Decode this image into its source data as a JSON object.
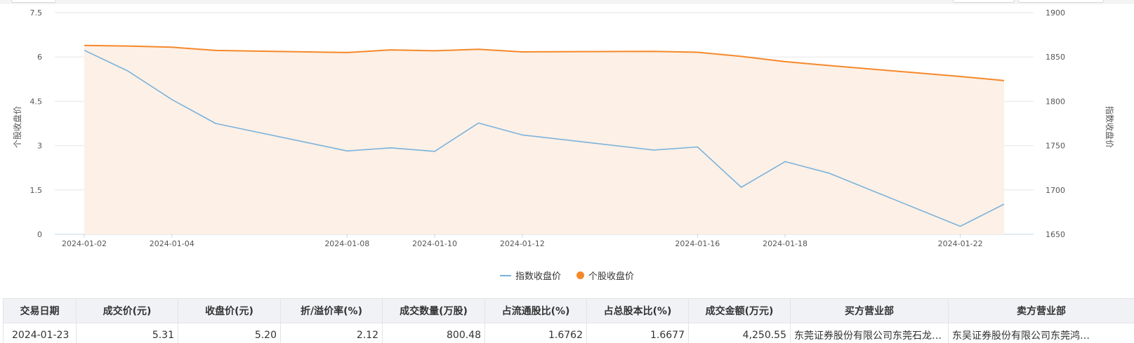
{
  "chart_data": {
    "type": "line",
    "x": [
      "2024-01-02",
      "2024-01-03",
      "2024-01-04",
      "2024-01-05",
      "2024-01-08",
      "2024-01-09",
      "2024-01-10",
      "2024-01-11",
      "2024-01-12",
      "2024-01-15",
      "2024-01-16",
      "2024-01-17",
      "2024-01-18",
      "2024-01-19",
      "2024-01-22",
      "2024-01-23"
    ],
    "x_tick_labels": [
      "2024-01-02",
      "2024-01-04",
      "2024-01-08",
      "2024-01-10",
      "2024-01-12",
      "2024-01-16",
      "2024-01-18",
      "2024-01-22"
    ],
    "ylabel_left": "个股收盘价",
    "ylabel_right": "指数收盘价",
    "ylim_left": [
      0,
      7.5
    ],
    "ylim_right": [
      1650,
      1900
    ],
    "yticks_left": [
      "0",
      "1.5",
      "3",
      "4.5",
      "6",
      "7.5"
    ],
    "yticks_right": [
      "1650",
      "1700",
      "1750",
      "1800",
      "1850",
      "1900"
    ],
    "grid": true,
    "legend_position": "bottom",
    "series": [
      {
        "name": "指数收盘价",
        "axis": "right",
        "color": "#7ab3dc",
        "values": [
          1857.5,
          1834,
          1802,
          1775,
          1744,
          1747.5,
          1743.5,
          1775.5,
          1762,
          1745,
          1748.5,
          1703,
          1732,
          1719,
          1659,
          1684
        ]
      },
      {
        "name": "个股收盘价",
        "axis": "left",
        "color": "#f5892a",
        "area_color": "#fdf0e6",
        "values": [
          6.39,
          6.37,
          6.33,
          6.22,
          6.15,
          6.24,
          6.21,
          6.26,
          6.17,
          6.19,
          6.16,
          6.02,
          5.84,
          5.71,
          5.34,
          5.2
        ]
      }
    ]
  },
  "table": {
    "headers": [
      "交易日期",
      "成交价(元)",
      "收盘价(元)",
      "折/溢价率(%)",
      "成交数量(万股)",
      "占流通股比(%)",
      "占总股本比(%)",
      "成交金额(万元)",
      "买方营业部",
      "卖方营业部"
    ],
    "rows": [
      [
        "2024-01-23",
        "5.31",
        "5.20",
        "2.12",
        "800.48",
        "1.6762",
        "1.6677",
        "4,250.55",
        "东莞证券股份有限公司东莞石龙…",
        "东吴证券股份有限公司东莞鸿…"
      ]
    ]
  }
}
